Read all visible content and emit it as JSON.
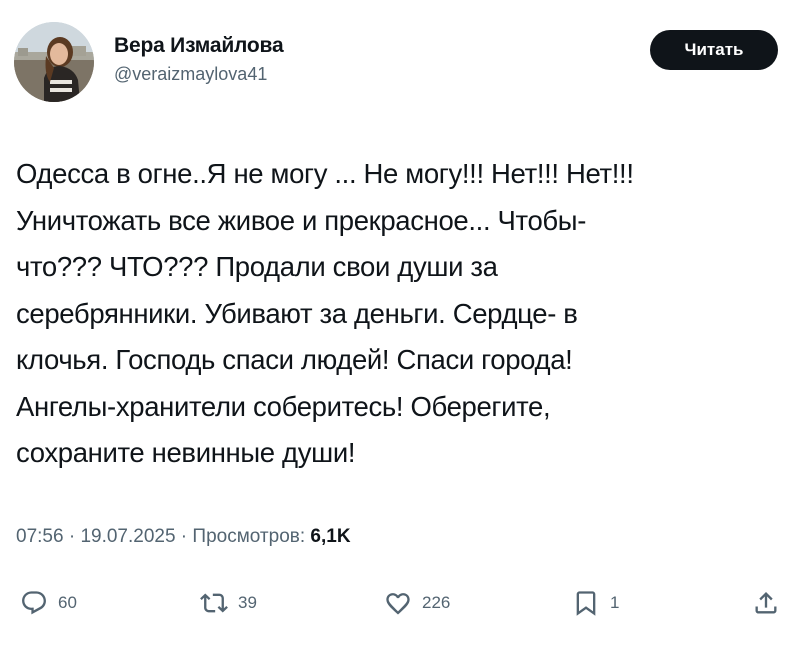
{
  "author": {
    "display_name": "Вера Измайлова",
    "handle": "@veraizmaylova41"
  },
  "follow_button": {
    "label": "Читать"
  },
  "tweet": {
    "lines": [
      "Одесса в огне..Я не могу ... Не могу!!! Нет!!! Нет!!!",
      "Уничтожать все живое и прекрасное... Чтобы-",
      "что??? ЧТО??? Продали свои души за",
      "серебрянники. Убивают за деньги. Сердце- в",
      "клочья. Господь спаси людей! Спаси города!",
      "Ангелы-хранители соберитесь! Оберегите,",
      "сохраните невинные души!"
    ]
  },
  "meta": {
    "time": "07:56",
    "separator": " · ",
    "date": "19.07.2025",
    "views_label": "Просмотров:",
    "views_count": "6,1K"
  },
  "actions": {
    "replies": "60",
    "reposts": "39",
    "likes": "226",
    "bookmarks": "1"
  },
  "icons": {
    "reply": "reply-icon",
    "repost": "repost-icon",
    "like": "heart-icon",
    "bookmark": "bookmark-icon",
    "share": "share-icon"
  },
  "colors": {
    "text": "#0f1419",
    "secondary": "#536471",
    "button_bg": "#0f1419",
    "button_text": "#ffffff"
  }
}
